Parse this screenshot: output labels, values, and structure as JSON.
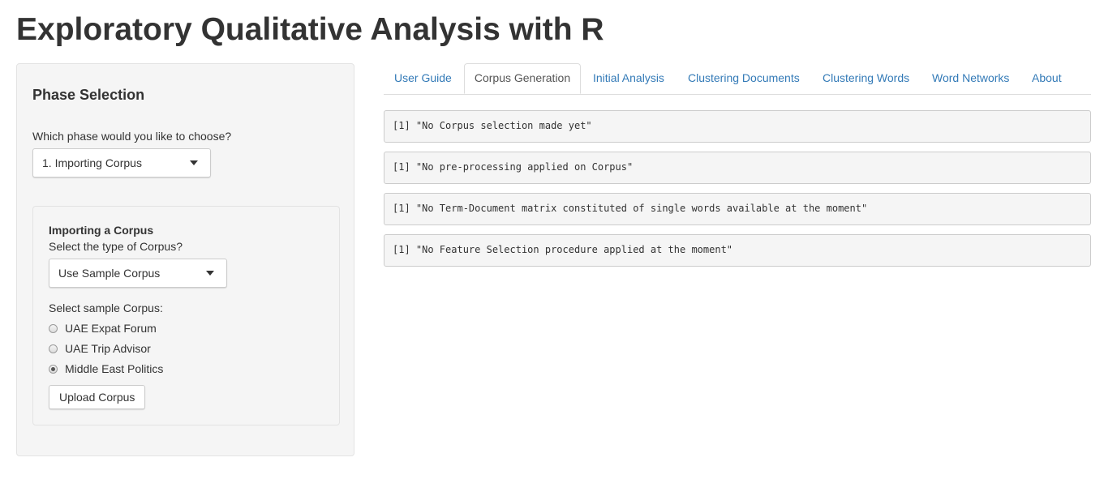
{
  "page": {
    "title": "Exploratory Qualitative Analysis with R"
  },
  "sidebar": {
    "heading": "Phase Selection",
    "phase_question": "Which phase would you like to choose?",
    "phase_select_value": "1. Importing Corpus",
    "import": {
      "title": "Importing a Corpus",
      "type_question": "Select the type of Corpus?",
      "type_select_value": "Use Sample Corpus",
      "sample_label": "Select sample Corpus:",
      "options": [
        {
          "label": "UAE Expat Forum",
          "checked": false
        },
        {
          "label": "UAE Trip Advisor",
          "checked": false
        },
        {
          "label": "Middle East Politics",
          "checked": true
        }
      ],
      "upload_button": "Upload Corpus"
    }
  },
  "tabs": [
    {
      "label": "User Guide",
      "active": false
    },
    {
      "label": "Corpus Generation",
      "active": true
    },
    {
      "label": "Initial Analysis",
      "active": false
    },
    {
      "label": "Clustering Documents",
      "active": false
    },
    {
      "label": "Clustering Words",
      "active": false
    },
    {
      "label": "Word Networks",
      "active": false
    },
    {
      "label": "About",
      "active": false
    }
  ],
  "outputs": [
    "[1] \"No Corpus selection made yet\"",
    "[1] \"No pre-processing applied on Corpus\"",
    "[1] \"No Term-Document matrix constituted of single words available at the moment\"",
    "[1] \"No Feature Selection procedure applied at the moment\""
  ],
  "colors": {
    "link": "#337ab7",
    "well_background": "#f5f5f5",
    "text": "#333333"
  }
}
